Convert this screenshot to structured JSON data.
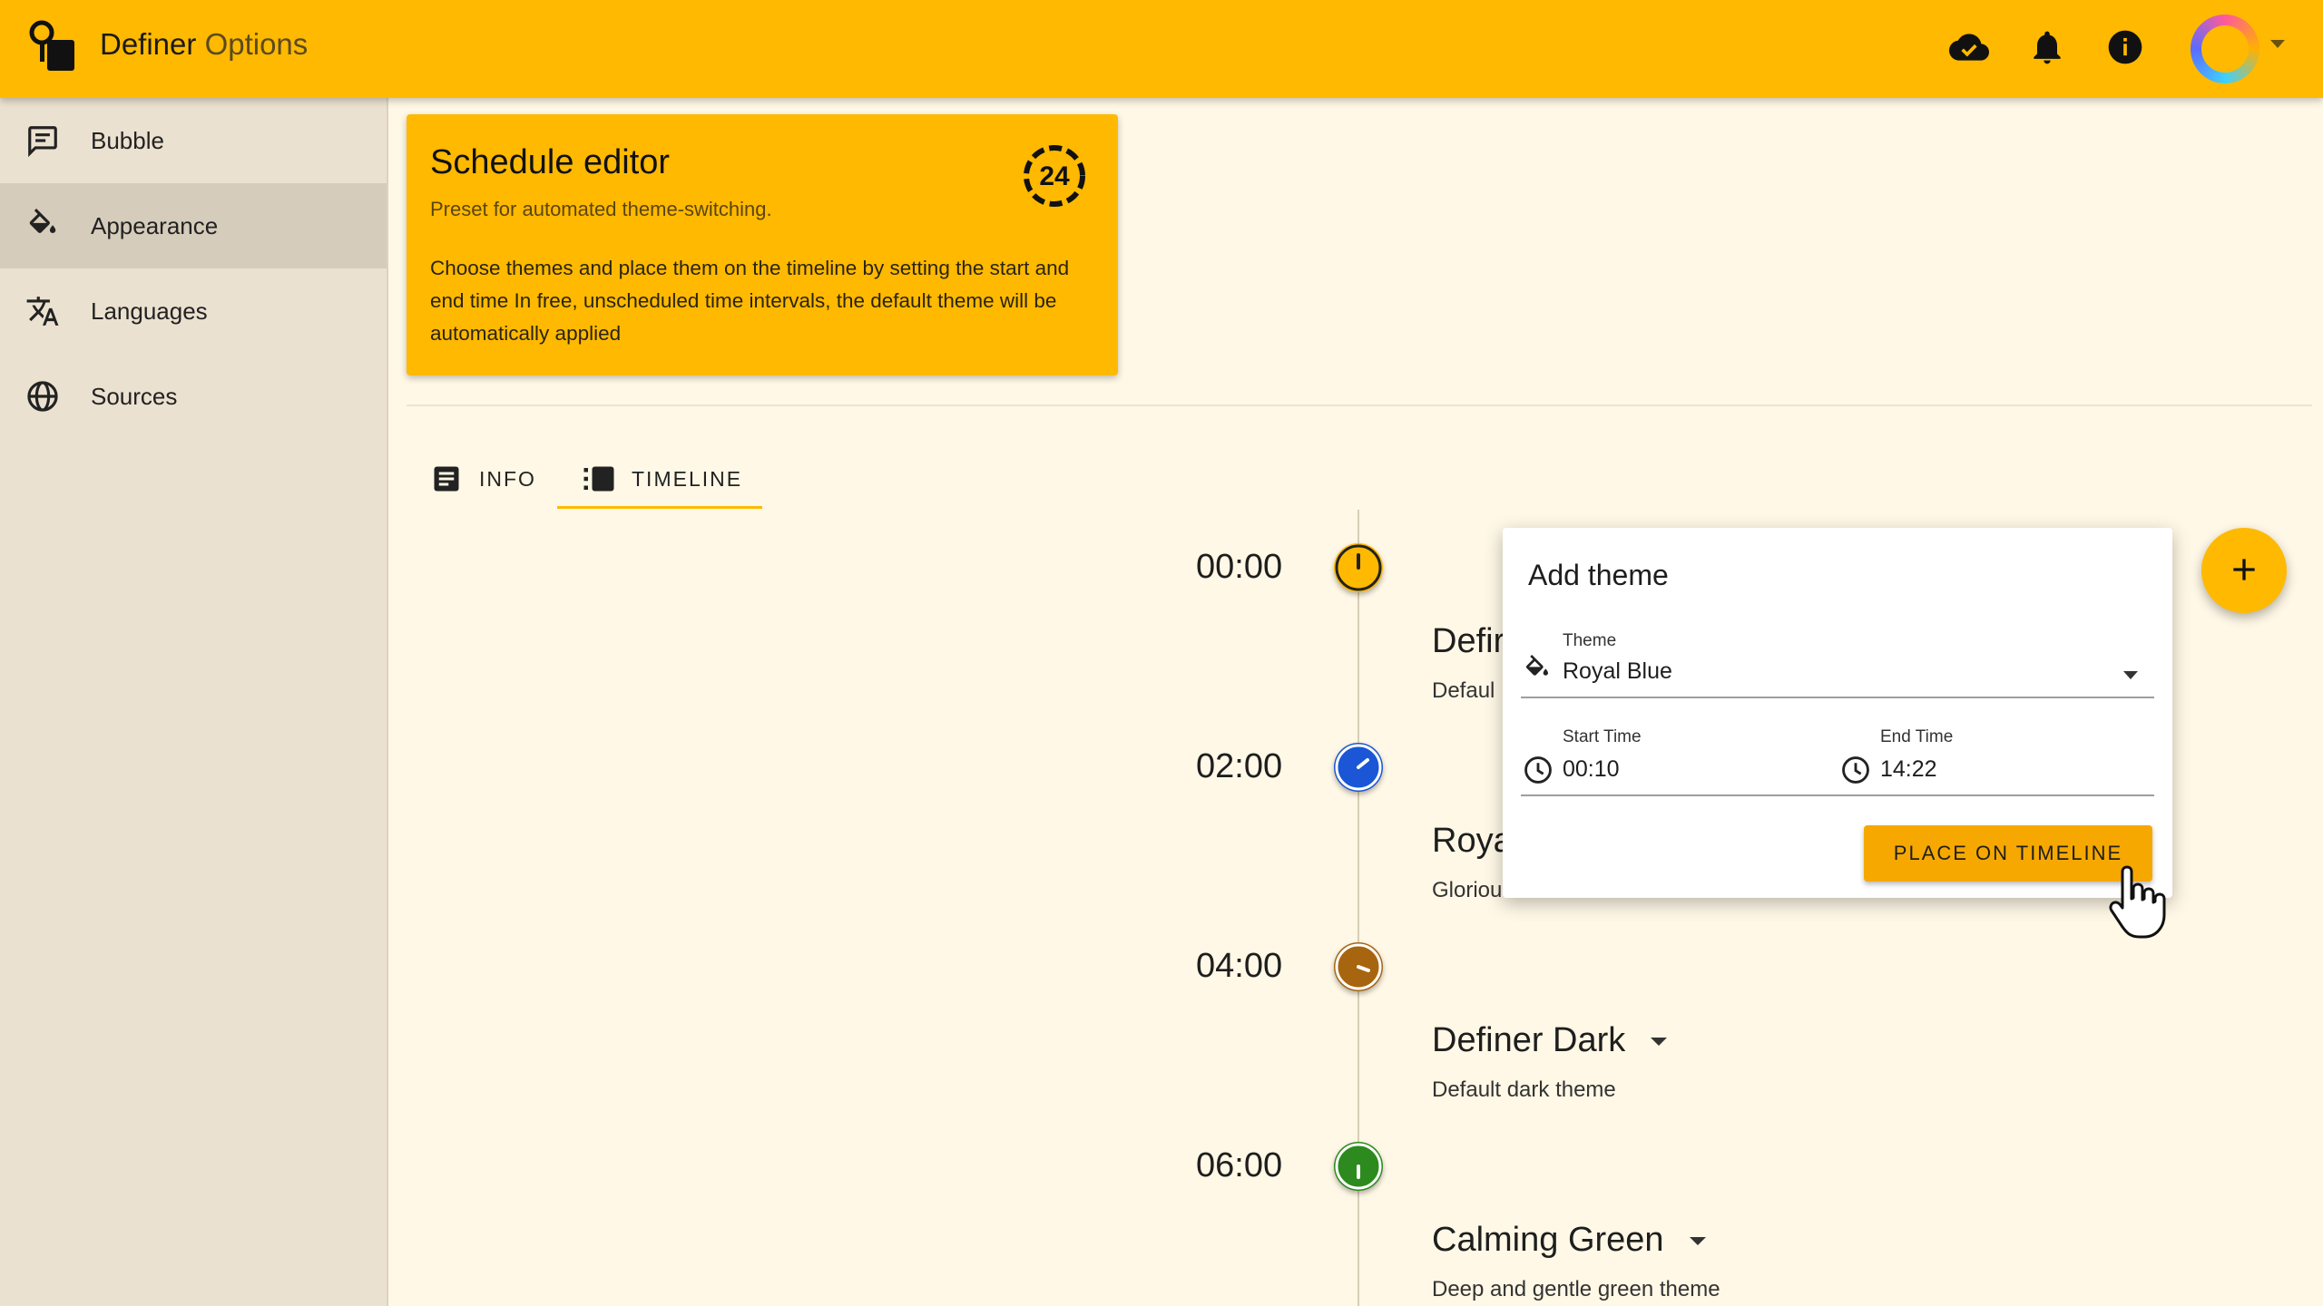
{
  "app": {
    "name": "Definer",
    "subtitle": "Options"
  },
  "topbar": {
    "icons": [
      "cloud-done-icon",
      "bell-icon",
      "info-icon"
    ],
    "avatar": "avatar"
  },
  "sidebar": {
    "items": [
      {
        "label": "Bubble",
        "icon": "chat-bubble-icon"
      },
      {
        "label": "Appearance",
        "icon": "paint-bucket-icon",
        "active": true
      },
      {
        "label": "Languages",
        "icon": "translate-icon"
      },
      {
        "label": "Sources",
        "icon": "globe-icon"
      }
    ]
  },
  "header_card": {
    "title": "Schedule editor",
    "subtitle": "Preset for automated theme-switching.",
    "body": "Choose themes and place them on the timeline by setting the start and end time In free, unscheduled time intervals, the default theme will be automatically applied",
    "icon": "24-hours-icon"
  },
  "tabs": [
    {
      "label": "INFO",
      "icon": "article-icon"
    },
    {
      "label": "TIMELINE",
      "icon": "timeline-icon",
      "active": true
    }
  ],
  "timeline": {
    "times": [
      "00:00",
      "02:00",
      "04:00",
      "06:00"
    ],
    "marker_colors": [
      "#ffb900",
      "#1a56d6",
      "#a8650f",
      "#2c8a1e"
    ],
    "themes": [
      {
        "name": "Defir",
        "desc": "Defaul"
      },
      {
        "name": "Roya",
        "desc": "Gloriou"
      },
      {
        "name": "Definer Dark",
        "desc": "Default dark theme"
      },
      {
        "name": "Calming Green",
        "desc": "Deep and gentle green theme"
      }
    ]
  },
  "dialog": {
    "title": "Add theme",
    "theme_label": "Theme",
    "theme_value": "Royal Blue",
    "start_label": "Start Time",
    "start_value": "00:10",
    "end_label": "End Time",
    "end_value": "14:22",
    "button": "PLACE ON TIMELINE"
  },
  "fab": {
    "icon": "plus-icon"
  },
  "colors": {
    "accent": "#ffb900",
    "sidebar": "#ebe1d0",
    "background": "#fff8e6"
  }
}
